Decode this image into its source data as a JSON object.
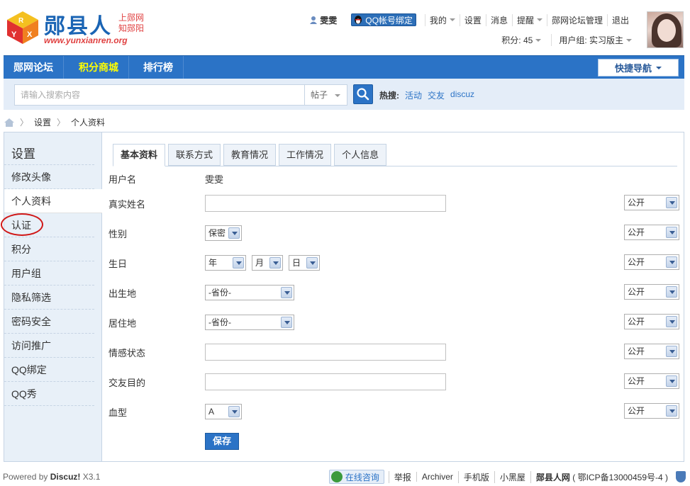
{
  "header": {
    "brand": "郧县人",
    "tag_line1": "上郧网",
    "tag_line2": "知郧阳",
    "url": "www.yunxianren.org",
    "username": "雯雯",
    "qq_bind": "QQ帐号绑定",
    "links": [
      "我的",
      "设置",
      "消息",
      "提醒",
      "郧网论坛管理",
      "退出"
    ],
    "points": "积分: 45",
    "group": "用户组: 实习版主"
  },
  "nav": {
    "tabs": [
      "郧网论坛",
      "积分商城",
      "排行榜"
    ],
    "quick": "快捷导航"
  },
  "search": {
    "placeholder": "请输入搜索内容",
    "type": "帖子",
    "hot_label": "热搜:",
    "hot": [
      "活动",
      "交友",
      "discuz"
    ]
  },
  "breadcrumb": [
    "设置",
    "个人资料"
  ],
  "sidebar": {
    "title": "设置",
    "items": [
      "修改头像",
      "个人资料",
      "认证",
      "积分",
      "用户组",
      "隐私筛选",
      "密码安全",
      "访问推广",
      "QQ绑定",
      "QQ秀"
    ]
  },
  "tabs": [
    "基本资料",
    "联系方式",
    "教育情况",
    "工作情况",
    "个人信息"
  ],
  "form": {
    "username_label": "用户名",
    "username_value": "雯雯",
    "realname_label": "真实姓名",
    "gender_label": "性别",
    "gender_value": "保密",
    "birthday_label": "生日",
    "year": "年",
    "month": "月",
    "day": "日",
    "birthplace_label": "出生地",
    "residence_label": "居住地",
    "province": "-省份-",
    "emotion_label": "情感状态",
    "purpose_label": "交友目的",
    "blood_label": "血型",
    "blood_value": "A",
    "privacy": "公开",
    "save": "保存"
  },
  "footer": {
    "powered": "Powered by",
    "discuz": "Discuz!",
    "version": "X3.1",
    "online": "在线咨询",
    "links": [
      "举报",
      "Archiver",
      "手机版",
      "小黑屋"
    ],
    "site": "郧县人网",
    "icp": "( 鄂ICP备13000459号-4 )"
  }
}
